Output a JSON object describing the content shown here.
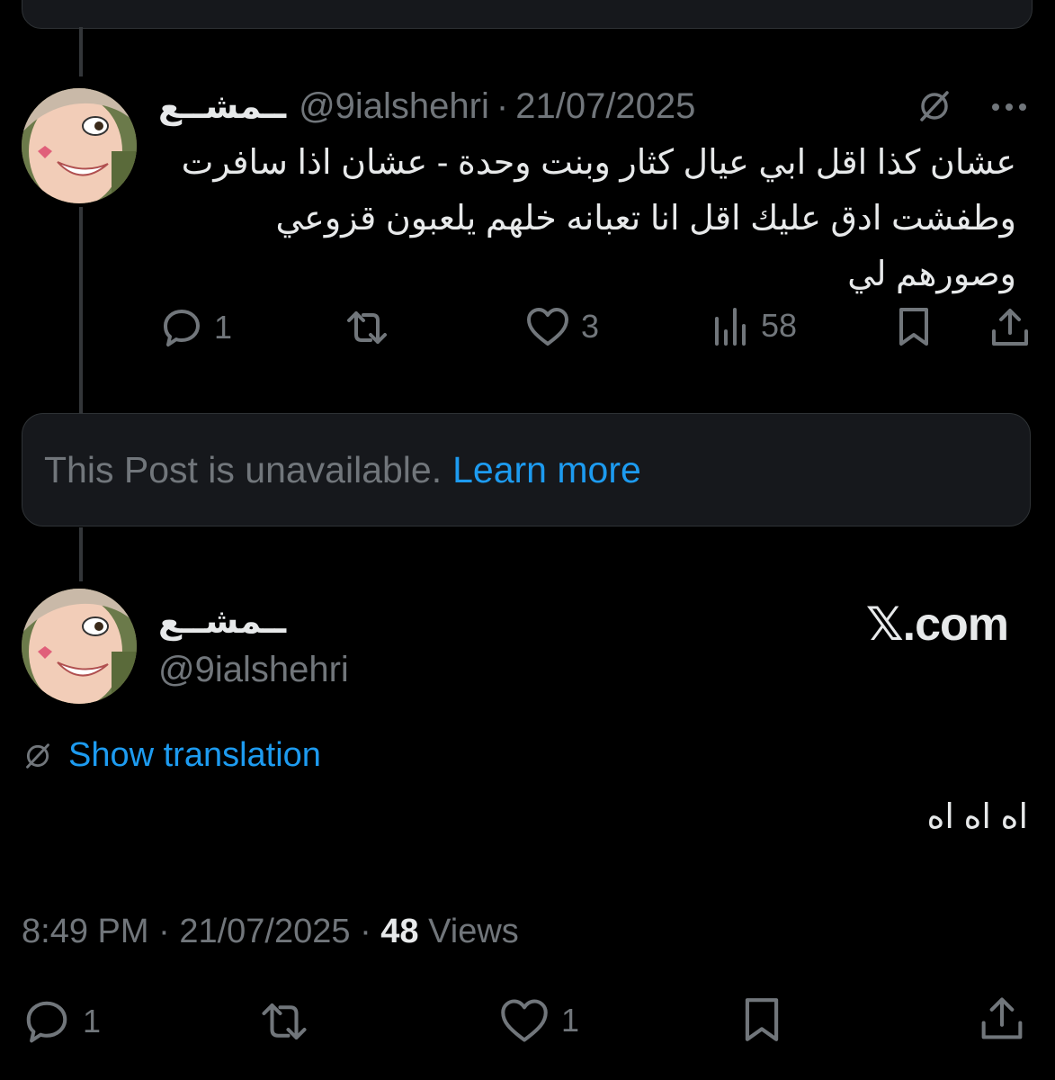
{
  "thread_post": {
    "display_name": "ــمشــع",
    "handle": "@9ialshehri",
    "date": "21/07/2025",
    "separator": "·",
    "text": "عشان كذا اقل ابي عيال كثار وبنت وحدة - عشان اذا سافرت وطفشت ادق عليك اقل انا تعبانه خلهم يلعبون قزوعي وصورهم لي",
    "replies": "1",
    "likes": "3",
    "views": "58",
    "icons": [
      "no-translate-icon",
      "more-icon",
      "reply-icon",
      "repost-icon",
      "like-icon",
      "views-icon",
      "bookmark-icon",
      "share-icon"
    ]
  },
  "unavailable": {
    "message": "This Post is unavailable.",
    "link": "Learn more"
  },
  "main_post": {
    "display_name": "ــمشــع",
    "handle": "@9ialshehri",
    "watermark": "𝕏.com",
    "translate_label": "Show translation",
    "text": "اه اه اه",
    "time": "8:49 PM",
    "date": "21/07/2025",
    "separator": "·",
    "views_count": "48",
    "views_label": "Views",
    "replies": "1",
    "likes": "1"
  },
  "colors": {
    "background": "#000000",
    "text": "#e7e9ea",
    "muted": "#71767b",
    "link": "#1d9bf0",
    "border": "#2f3336"
  }
}
